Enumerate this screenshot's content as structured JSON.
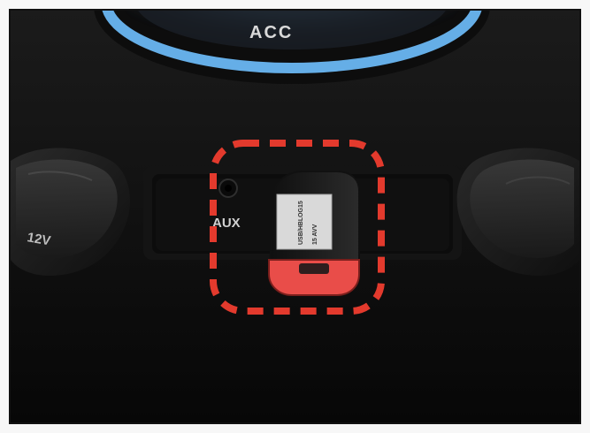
{
  "photo": {
    "acc_text": "ACC",
    "left_socket_label": "12V",
    "aux_label": "AUX",
    "usb_stick_label_line1": "USB/HB­LOG15",
    "usb_stick_label_line2": "15 AVV",
    "colors": {
      "highlight": "#e33a2d",
      "usb_red": "#e94d49"
    }
  }
}
